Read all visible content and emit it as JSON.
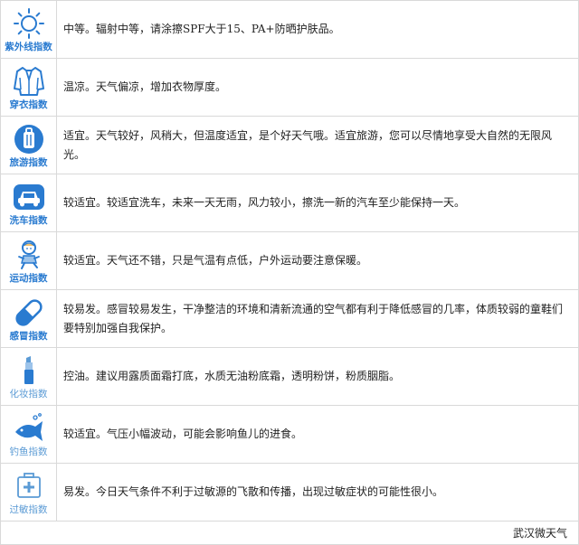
{
  "colors": {
    "icon_blue": "#2a7bd0",
    "light_blue": "#5b9bd5",
    "border": "#d9d9d9"
  },
  "rows": [
    {
      "icon": "sun-icon",
      "label": "紫外线指数",
      "text": "中等。辐射中等，请涂擦SPF大于15、PA+防晒护肤品。"
    },
    {
      "icon": "coat-icon",
      "label": "穿衣指数",
      "text": "温凉。天气偏凉，增加衣物厚度。"
    },
    {
      "icon": "luggage-icon",
      "label": "旅游指数",
      "text": "适宜。天气较好，风稍大，但温度适宜，是个好天气哦。适宜旅游，您可以尽情地享受大自然的无限风光。"
    },
    {
      "icon": "car-icon",
      "label": "洗车指数",
      "text": "较适宜。较适宜洗车，未来一天无雨，风力较小，擦洗一新的汽车至少能保持一天。"
    },
    {
      "icon": "runner-icon",
      "label": "运动指数",
      "text": "较适宜。天气还不错，只是气温有点低，户外运动要注意保暖。"
    },
    {
      "icon": "pill-icon",
      "label": "感冒指数",
      "text": "较易发。感冒较易发生，干净整洁的环境和清新流通的空气都有利于降低感冒的几率，体质较弱的童鞋们要特别加强自我保护。"
    },
    {
      "icon": "lipstick-icon",
      "label": "化妆指数",
      "text": "控油。建议用露质面霜打底，水质无油粉底霜，透明粉饼，粉质胭脂。"
    },
    {
      "icon": "fish-icon",
      "label": "钓鱼指数",
      "text": "较适宜。气压小幅波动，可能会影响鱼儿的进食。"
    },
    {
      "icon": "first-aid-kit-icon",
      "label": "过敏指数",
      "text": "易发。今日天气条件不利于过敏源的飞散和传播，出现过敏症状的可能性很小。"
    }
  ],
  "footer": {
    "source": "武汉微天气"
  }
}
